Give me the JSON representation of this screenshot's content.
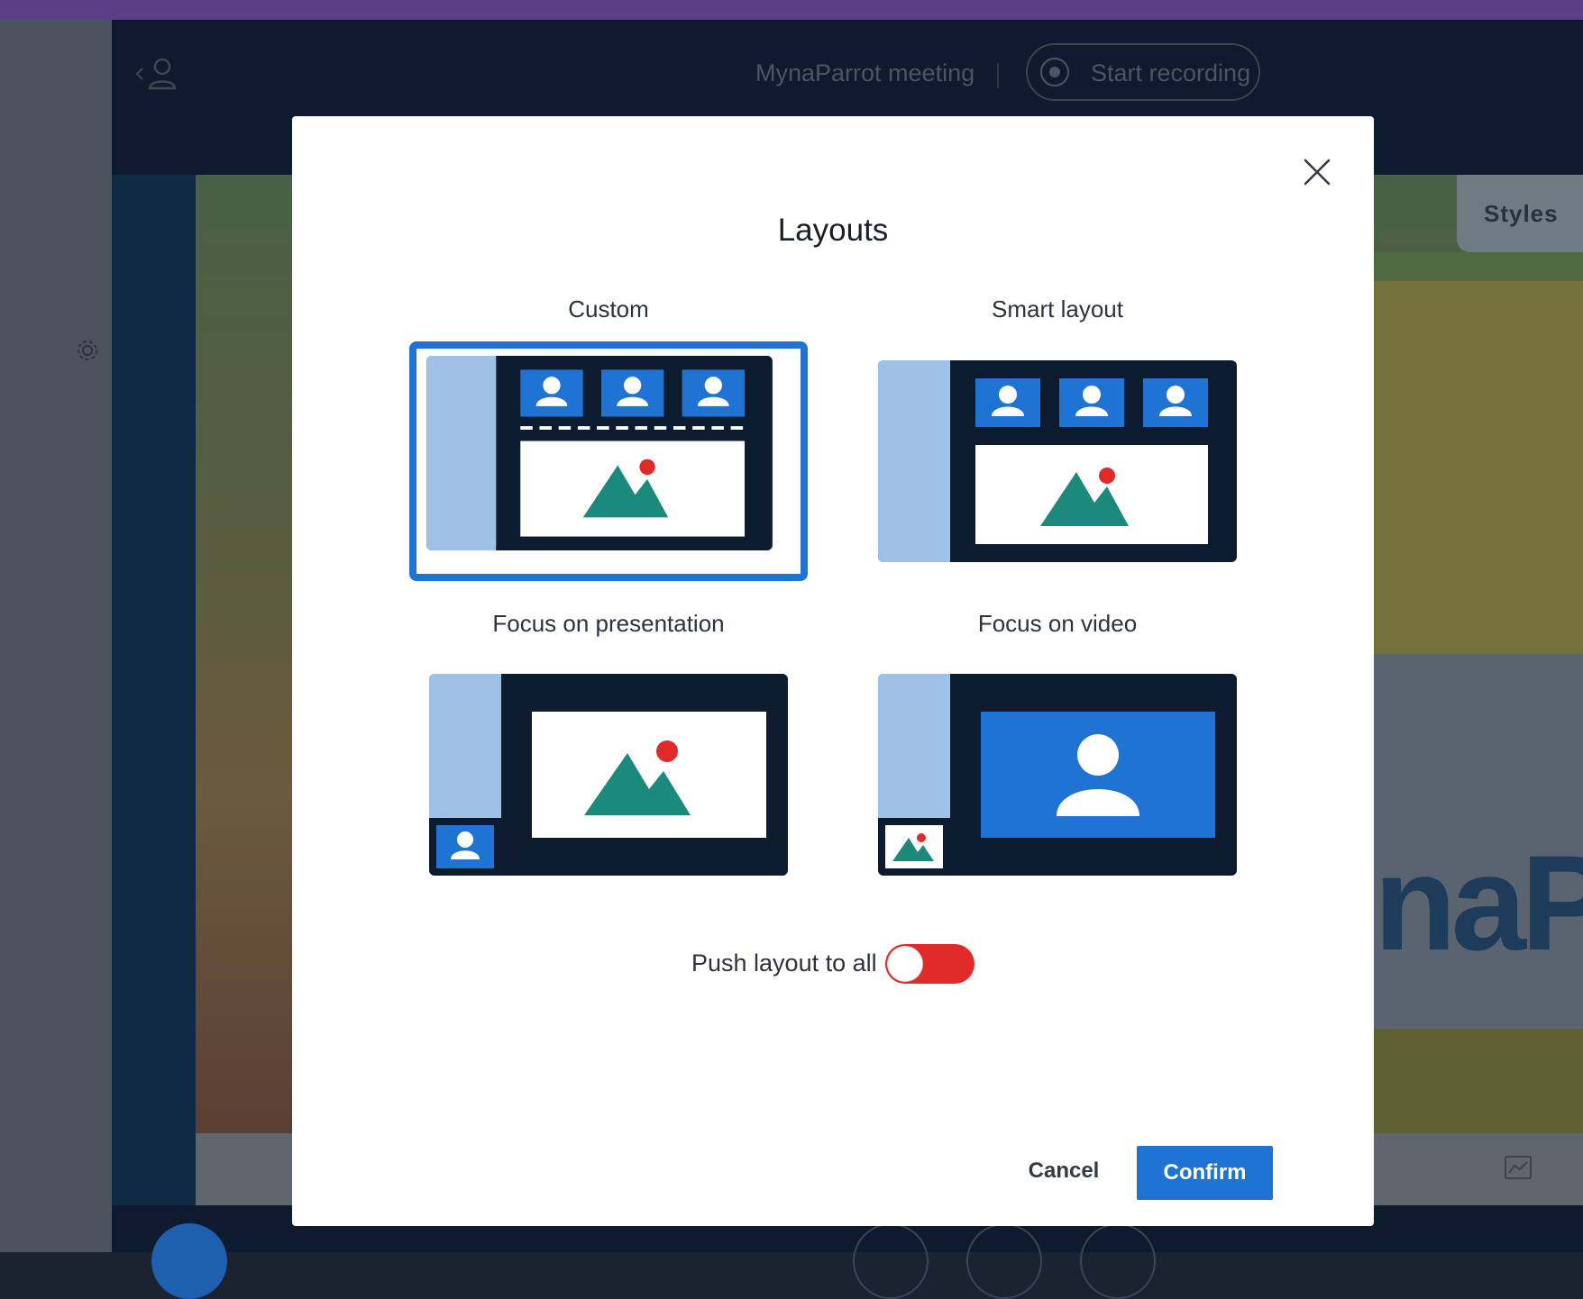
{
  "header": {
    "meeting_title": "MynaParrot meeting",
    "record_label": "Start recording"
  },
  "sidebar": {
    "styles_label": "Styles"
  },
  "modal": {
    "title": "Layouts",
    "options": [
      {
        "label": "Custom",
        "icon": "layout-custom-icon",
        "selected": true
      },
      {
        "label": "Smart layout",
        "icon": "layout-smart-icon",
        "selected": false
      },
      {
        "label": "Focus on presentation",
        "icon": "layout-presentation-icon",
        "selected": false
      },
      {
        "label": "Focus on video",
        "icon": "layout-video-icon",
        "selected": false
      }
    ],
    "push_label": "Push layout to all",
    "push_enabled": false,
    "cancel_label": "Cancel",
    "confirm_label": "Confirm"
  },
  "colors": {
    "accent": "#1f73d2",
    "toggle_off": "#e12b2b",
    "thumb_dark": "#0d1b2e",
    "thumb_sidebar": "#9fc1e8",
    "mountain": "#1b8a7c",
    "sun": "#e02a2a"
  }
}
